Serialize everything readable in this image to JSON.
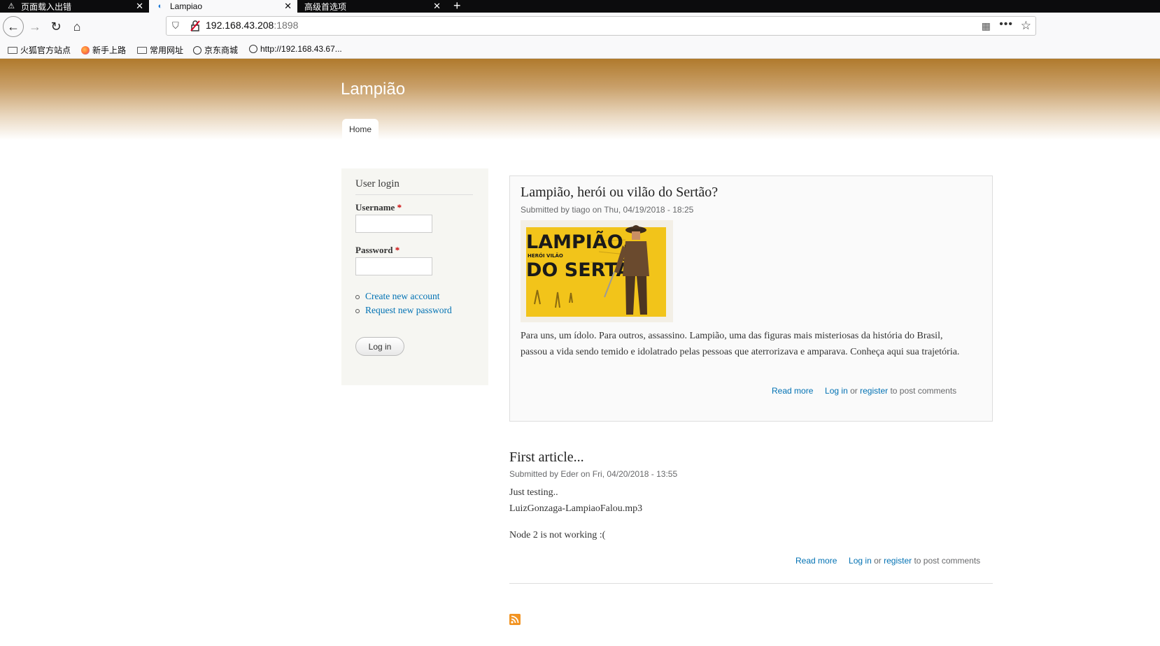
{
  "browser": {
    "tabs": [
      {
        "title": "页面载入出错",
        "active": false
      },
      {
        "title": "Lampiao",
        "active": true
      },
      {
        "title": "高级首选项",
        "active": false
      }
    ],
    "url_host": "192.168.43.208",
    "url_port": ":1898",
    "bookmarks": [
      "火狐官方站点",
      "新手上路",
      "常用网址",
      "京东商城",
      "http://192.168.43.67..."
    ],
    "icons": {
      "back": "back-arrow-icon",
      "forward": "forward-arrow-icon",
      "reload": "reload-icon",
      "home": "home-icon"
    }
  },
  "site": {
    "name": "Lampião",
    "nav_home": "Home"
  },
  "login": {
    "title": "User login",
    "username_label": "Username",
    "password_label": "Password",
    "required_mark": "*",
    "create_account": "Create new account",
    "request_password": "Request new password",
    "button": "Log in"
  },
  "articles": [
    {
      "title": "Lampião, herói ou vilão do Sertão?",
      "meta": "Submitted by tiago on Thu, 04/19/2018 - 18:25",
      "body": "Para uns, um ídolo. Para outros, assassino. Lampião, uma das figuras mais misteriosas da história do Brasil, passou a vida sendo temido e idolatrado pelas pessoas que aterrorizava e amparava. Conheça aqui sua trajetória.",
      "image_lines": [
        "LAMPIÃO,",
        "HERÓI  VILÃO",
        "DO SERTÃO"
      ],
      "read_more": "Read more",
      "log_in": "Log in",
      "or": "or",
      "register": "register",
      "post_comments": "to post comments"
    },
    {
      "title": "First article...",
      "meta": "Submitted by Eder on Fri, 04/20/2018 - 13:55",
      "line1": "Just testing..",
      "line2": "LuizGonzaga-LampiaoFalou.mp3",
      "line3": "Node 2 is not working :(",
      "read_more": "Read more",
      "log_in": "Log in",
      "or": "or",
      "register": "register",
      "post_comments": "to post comments"
    }
  ],
  "colors": {
    "link": "#0071b3",
    "header_top": "#b07a2c",
    "rss": "#f29423"
  }
}
